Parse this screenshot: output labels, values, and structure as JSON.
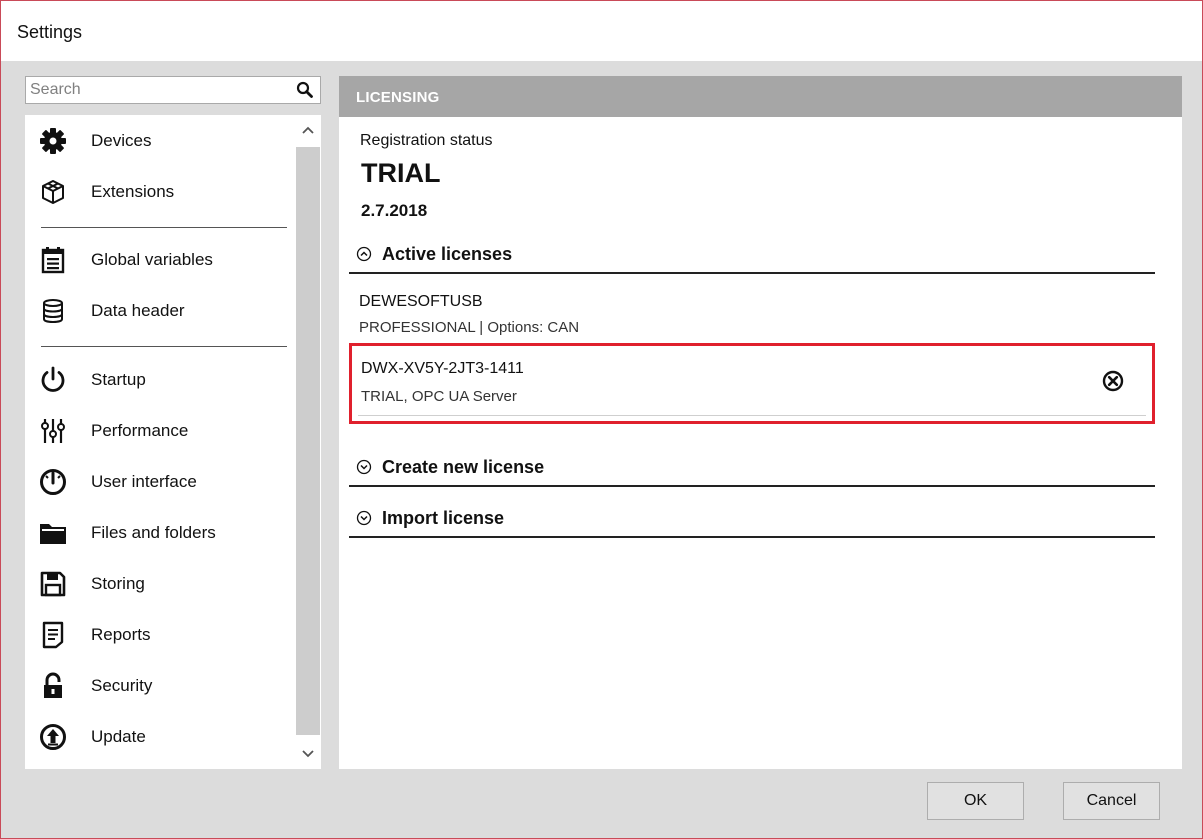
{
  "window": {
    "title": "Settings"
  },
  "search": {
    "placeholder": "Search",
    "value": ""
  },
  "sidebar": {
    "items": [
      {
        "label": "Devices",
        "icon": "gear-icon"
      },
      {
        "label": "Extensions",
        "icon": "cube-icon"
      },
      {
        "label": "Global variables",
        "icon": "clipboard-list-icon"
      },
      {
        "label": "Data header",
        "icon": "database-icon"
      },
      {
        "label": "Startup",
        "icon": "power-icon"
      },
      {
        "label": "Performance",
        "icon": "sliders-icon"
      },
      {
        "label": "User interface",
        "icon": "gauge-icon"
      },
      {
        "label": "Files and folders",
        "icon": "folder-icon"
      },
      {
        "label": "Storing",
        "icon": "floppy-disk-icon"
      },
      {
        "label": "Reports",
        "icon": "document-icon"
      },
      {
        "label": "Security",
        "icon": "lock-icon"
      },
      {
        "label": "Update",
        "icon": "upload-circle-icon"
      }
    ]
  },
  "panel": {
    "header": "LICENSING",
    "registration_label": "Registration status",
    "status": "TRIAL",
    "date": "2.7.2018",
    "sections": {
      "active": {
        "label": "Active licenses",
        "expanded": true
      },
      "create": {
        "label": "Create new license",
        "expanded": false
      },
      "import": {
        "label": "Import license",
        "expanded": false
      }
    },
    "licenses": [
      {
        "name": "DEWESOFTUSB",
        "description": "PROFESSIONAL | Options: CAN"
      },
      {
        "name": "DWX-XV5Y-2JT3-1411",
        "description": "TRIAL, OPC UA Server",
        "highlighted": true,
        "highlight_color": "#e0202d"
      }
    ]
  },
  "footer": {
    "ok_label": "OK",
    "cancel_label": "Cancel"
  }
}
